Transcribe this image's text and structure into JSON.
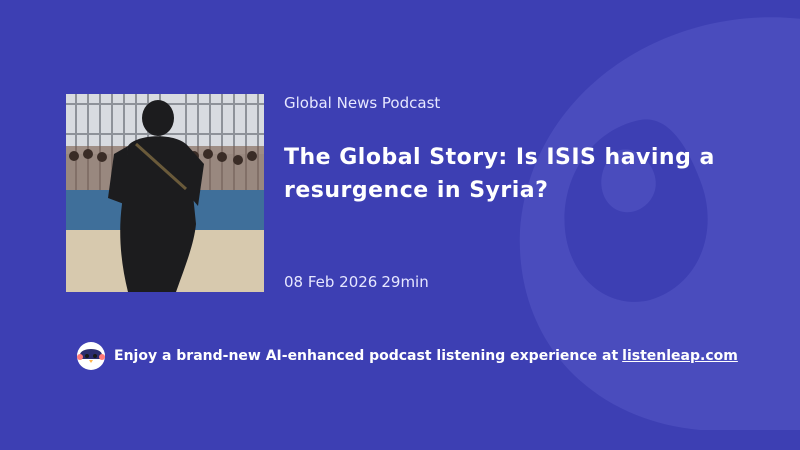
{
  "podcast": {
    "name": "Global News Podcast"
  },
  "episode": {
    "title": "The Global Story: Is ISIS having a resurgence in Syria?",
    "date": "08 Feb 2026",
    "duration": "29min"
  },
  "promo": {
    "text": "Enjoy a brand-new AI-enhanced podcast listening experience at",
    "link_text": "listenleap.com"
  },
  "colors": {
    "background": "#3d3fb3",
    "text": "#ffffff"
  },
  "icons": [
    "listenleap-logo-watermark",
    "penguin-mascot-icon"
  ]
}
